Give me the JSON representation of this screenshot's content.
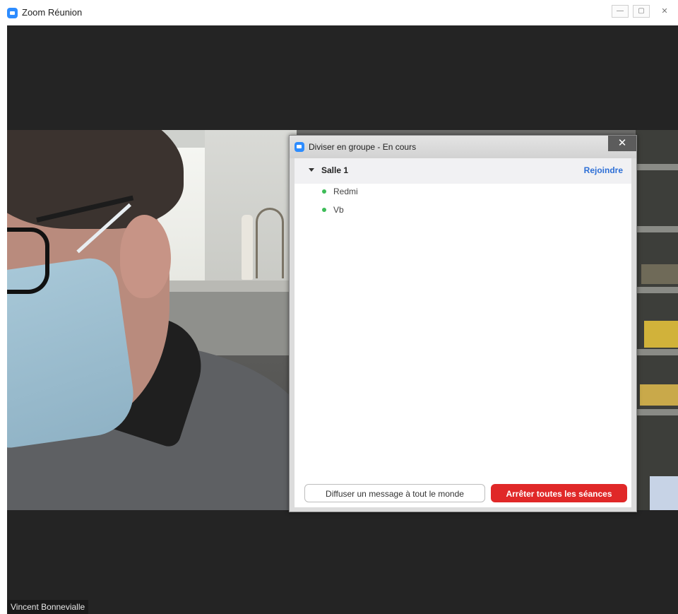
{
  "window": {
    "title": "Zoom Réunion",
    "icon": "zoom-icon",
    "controls": {
      "minimize": "—",
      "maximize": "▢",
      "close": "✕"
    }
  },
  "video": {
    "participant_name": "Vincent Bonnevialle"
  },
  "breakout_dialog": {
    "title": "Diviser en groupe - En cours",
    "close_symbol": "✕",
    "rooms": [
      {
        "name": "Salle 1",
        "join_label": "Rejoindre",
        "participants": [
          {
            "name": "Redmi",
            "status": "online"
          },
          {
            "name": "Vb",
            "status": "online"
          }
        ]
      }
    ],
    "broadcast_label": "Diffuser un message à tout le monde",
    "stop_all_label": "Arrêter toutes les séances"
  },
  "colors": {
    "accent_blue": "#2d8cff",
    "link_blue": "#2d6fd6",
    "stop_red": "#e02828",
    "online_green": "#3dbc58"
  }
}
